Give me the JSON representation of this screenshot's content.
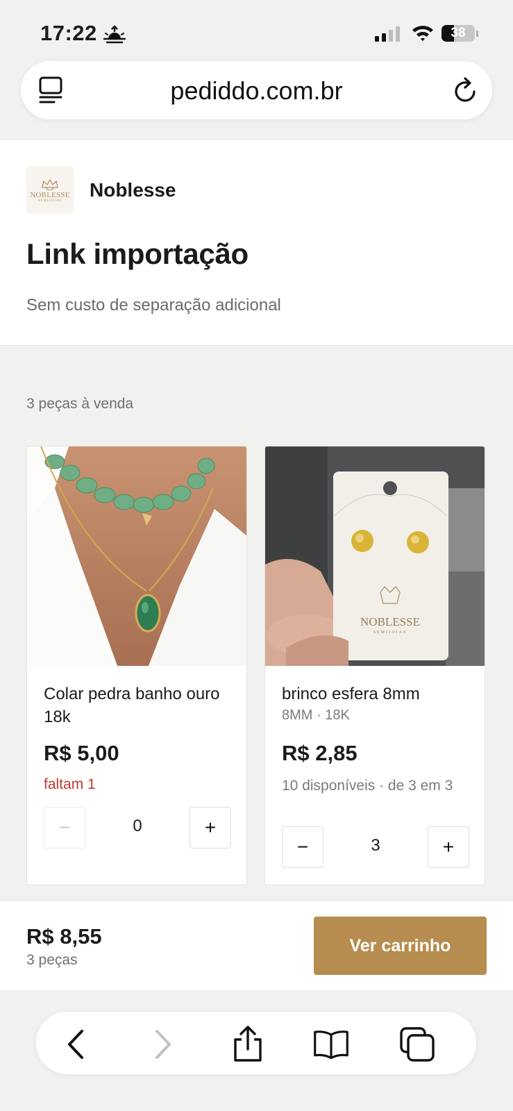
{
  "status_bar": {
    "time": "17:22",
    "battery_percent": "38",
    "icons": [
      "sunset-icon",
      "signal-icon",
      "wifi-icon",
      "battery-icon"
    ]
  },
  "browser": {
    "url": "pediddo.com.br",
    "icons": [
      "tabs-icon",
      "reload-icon"
    ]
  },
  "store": {
    "name": "Noblesse",
    "logo_text": "NOBLESSE",
    "logo_subtext": "SEMIJOIAS"
  },
  "page": {
    "title": "Link importação",
    "subtitle": "Sem custo de separação adicional",
    "count": "3 peças à venda"
  },
  "products": [
    {
      "name": "Colar pedra banho ouro 18k",
      "variant": "",
      "price": "R$ 5,00",
      "stock": "faltam 1",
      "quantity": "0",
      "minus": "−",
      "plus": "+"
    },
    {
      "name": "brinco esfera 8mm",
      "variant": "8MM · 18K",
      "price": "R$ 2,85",
      "stock": "10 disponíveis · de 3 em 3",
      "quantity": "3",
      "minus": "−",
      "plus": "+",
      "card_text": "NOBLESSE",
      "card_subtext": "SEMIJOIAS"
    }
  ],
  "footer": {
    "total": "R$ 8,55",
    "pieces": "3 peças",
    "cart_button": "Ver carrinho"
  },
  "toolbar": {
    "icons": [
      "back-icon",
      "forward-icon",
      "share-icon",
      "bookmarks-icon",
      "tabs-overview-icon"
    ]
  },
  "colors": {
    "accent": "#b78c4f",
    "warning": "#c0392b",
    "background": "#f1f1ef"
  }
}
